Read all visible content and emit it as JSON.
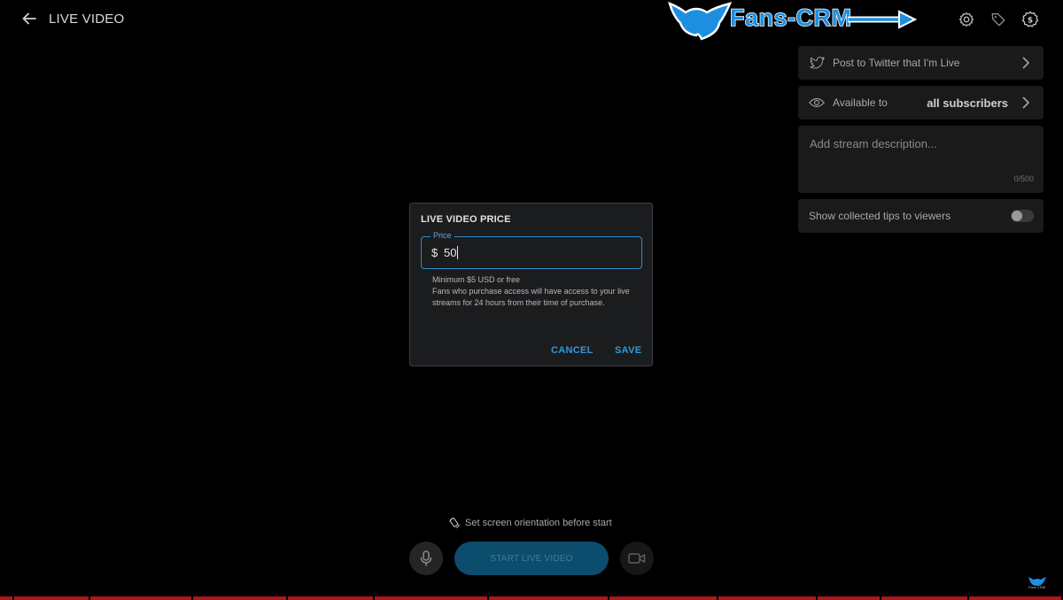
{
  "header": {
    "title": "LIVE VIDEO",
    "icons": [
      "back-arrow-icon",
      "gear-icon",
      "tag-icon",
      "dollar-badge-icon"
    ]
  },
  "watermark": {
    "brand": "Fans-CRM",
    "mini": "Fans CRM"
  },
  "sidebar": {
    "twitter_label": "Post to Twitter that I'm Live",
    "available_label": "Available to",
    "available_value": "all subscribers",
    "description_placeholder": "Add stream description...",
    "description_counter": "0/500",
    "tips_label": "Show collected tips to viewers",
    "tips_enabled": false
  },
  "dialog": {
    "title": "LIVE VIDEO PRICE",
    "field_label": "Price",
    "currency": "$",
    "value": "50",
    "help_min": "Minimum $5 USD or free",
    "help_access": "Fans who purchase access will have access to your live streams for 24 hours from their time of purchase.",
    "cancel_label": "CANCEL",
    "save_label": "SAVE"
  },
  "controls": {
    "orientation_hint": "Set screen orientation before start",
    "start_label": "START LIVE VIDEO"
  },
  "colors": {
    "accent": "#2e9ad9",
    "background": "#000000",
    "panel": "#1a1a1b",
    "start_button": "#0c4c6c"
  }
}
